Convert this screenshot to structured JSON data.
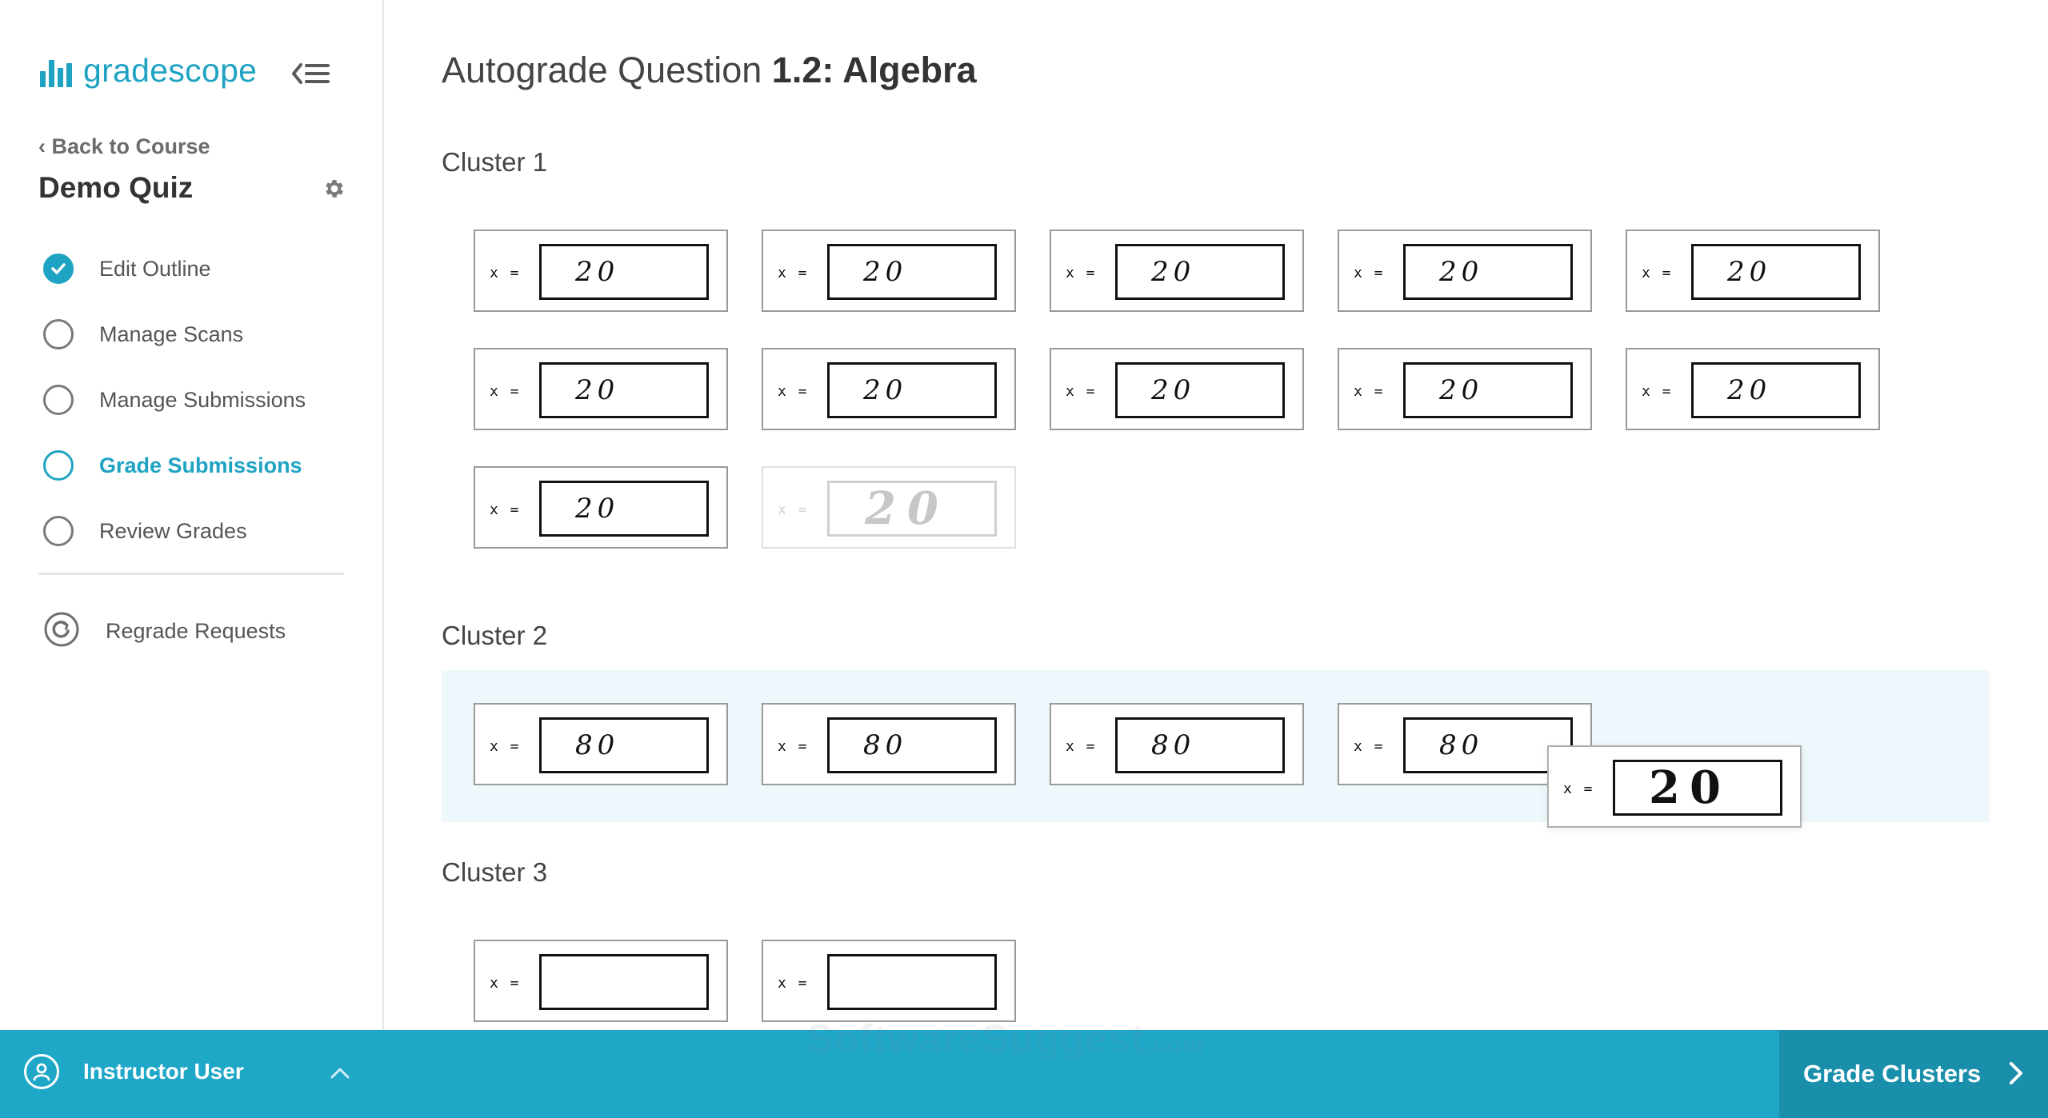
{
  "brand": {
    "name": "gradescope",
    "color": "#1fa3c3"
  },
  "sidebar": {
    "back_label": "Back to Course",
    "course_title": "Demo Quiz",
    "nav": [
      {
        "label": "Edit Outline",
        "state": "done"
      },
      {
        "label": "Manage Scans",
        "state": "todo"
      },
      {
        "label": "Manage Submissions",
        "state": "todo"
      },
      {
        "label": "Grade Submissions",
        "state": "active"
      },
      {
        "label": "Review Grades",
        "state": "todo"
      }
    ],
    "regrade_label": "Regrade Requests"
  },
  "main": {
    "title_prefix": "Autograde Question",
    "title_bold": "1.2: Algebra",
    "answer_label": "x =",
    "clusters": [
      {
        "title": "Cluster 1",
        "answers": [
          "20",
          "20",
          "20",
          "20",
          "20",
          "20",
          "20",
          "20",
          "20",
          "20",
          "20",
          "20"
        ],
        "ghost_placeholder": "20"
      },
      {
        "title": "Cluster 2",
        "answers": [
          "80",
          "80",
          "80",
          "80"
        ],
        "highlighted": true,
        "dragged_card": "20"
      },
      {
        "title": "Cluster 3",
        "answers": [
          "",
          ""
        ]
      }
    ]
  },
  "footer": {
    "user_name": "Instructor User",
    "primary_action": "Grade Clusters",
    "color": "#1fa7c8",
    "action_color": "#1a8fac"
  },
  "watermark": {
    "main": "SoftwareSuggest",
    "suffix": ".com"
  }
}
